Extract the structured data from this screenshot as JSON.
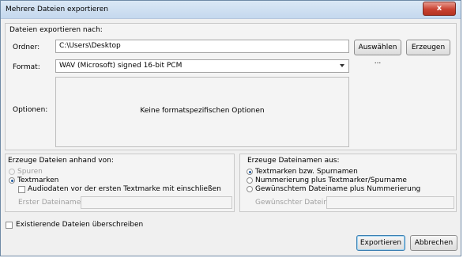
{
  "window": {
    "title": "Mehrere Dateien exportieren",
    "close_symbol": "x"
  },
  "export_to": {
    "heading": "Dateien exportieren nach:",
    "folder_label": "Ordner:",
    "folder_value": "C:\\Users\\Desktop",
    "browse_button": "Auswählen ...",
    "create_button": "Erzeugen",
    "format_label": "Format:",
    "format_value": "WAV (Microsoft) signed 16-bit PCM",
    "options_label": "Optionen:",
    "options_text": "Keine formatspezifischen Optionen"
  },
  "split_files": {
    "heading": "Erzeuge Dateien anhand von:",
    "tracks_label": "Spuren",
    "labels_label": "Textmarken",
    "include_audio_label": "Audiodaten vor der ersten Textmarke mit einschließen",
    "first_filename_label": "Erster Dateiname:",
    "first_filename_value": ""
  },
  "name_files": {
    "heading": "Erzeuge Dateinamen aus:",
    "option_label_track": "Textmarken bzw. Spurnamen",
    "option_numbering": "Nummerierung plus Textmarker/Spurname",
    "option_custom": "Gewünschtem Dateiname plus Nummerierung",
    "custom_filename_label": "Gewünschter Dateiname:",
    "custom_filename_value": ""
  },
  "overwrite_label": "Existierende Dateien überschreiben",
  "buttons": {
    "export": "Exportieren",
    "cancel": "Abbrechen"
  }
}
